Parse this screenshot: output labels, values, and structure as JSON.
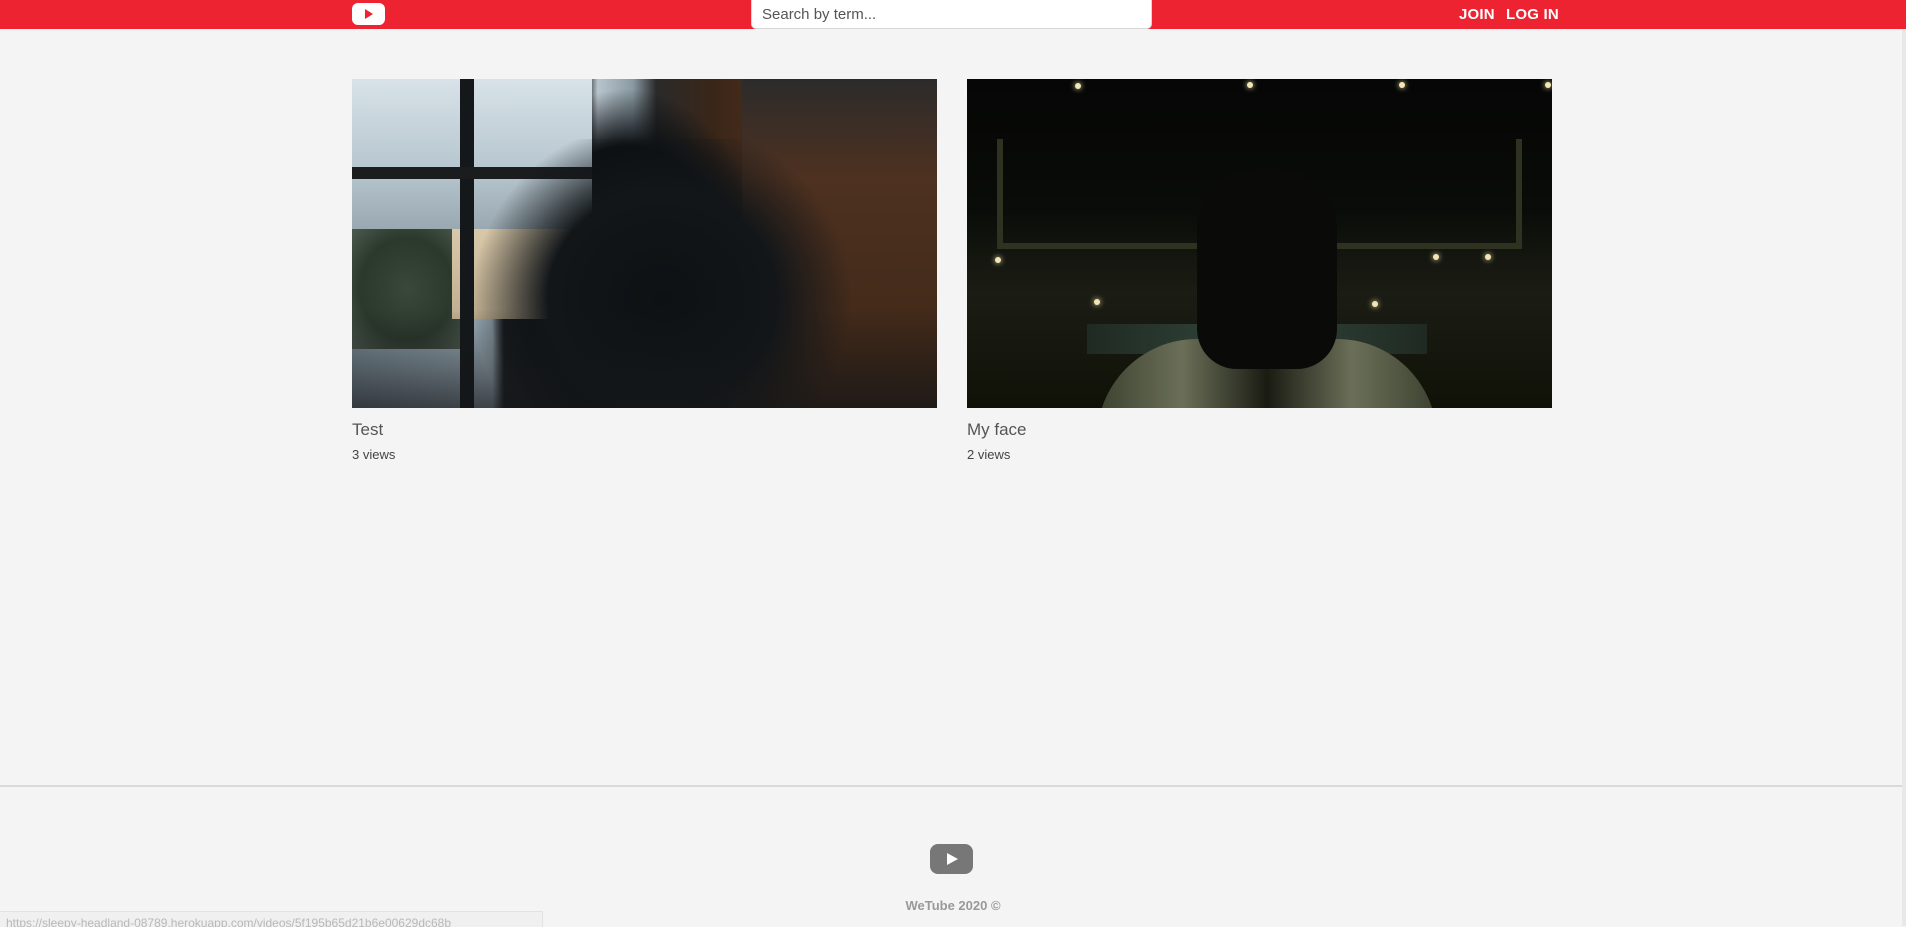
{
  "header": {
    "logo_icon": "youtube-play-icon",
    "search_placeholder": "Search by term...",
    "join_label": "JOIN",
    "login_label": "LOG IN",
    "brand_color": "#ee2331"
  },
  "videos": [
    {
      "title": "Test",
      "views": "3 views"
    },
    {
      "title": "My face",
      "views": "2 views"
    }
  ],
  "footer": {
    "logo_icon": "youtube-play-icon",
    "copyright": "WeTube 2020 ©"
  },
  "status_bar": {
    "url": "https://sleepy-headland-08789.herokuapp.com/videos/5f195b65d21b6e00629dc68b"
  }
}
